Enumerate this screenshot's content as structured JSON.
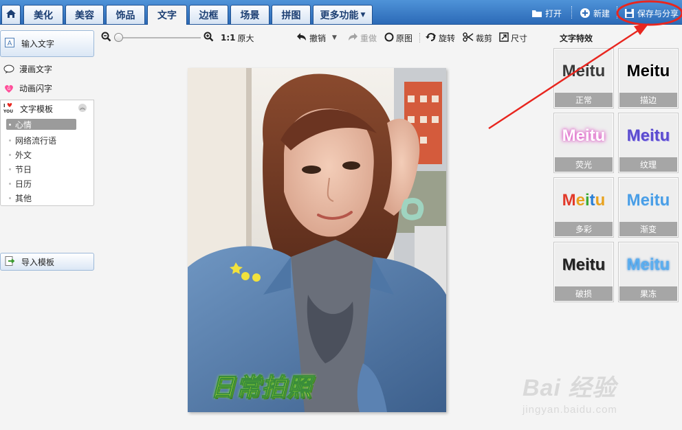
{
  "tabs": [
    {
      "id": "home",
      "label": ""
    },
    {
      "id": "beautify",
      "label": "美化"
    },
    {
      "id": "beauty",
      "label": "美容"
    },
    {
      "id": "accessories",
      "label": "饰品"
    },
    {
      "id": "text",
      "label": "文字"
    },
    {
      "id": "frame",
      "label": "边框"
    },
    {
      "id": "scene",
      "label": "场景"
    },
    {
      "id": "collage",
      "label": "拼图"
    },
    {
      "id": "more",
      "label": "更多功能"
    }
  ],
  "active_tab": "文字",
  "actions": {
    "open": "打开",
    "new": "新建",
    "save_share": "保存与分享"
  },
  "left": {
    "input_text": "输入文字",
    "comic_text": "漫画文字",
    "animated_text": "动画闪字",
    "text_template": "文字模板",
    "template_items": [
      "心情",
      "网络流行语",
      "外文",
      "节日",
      "日历",
      "其他"
    ],
    "selected_template": "心情",
    "import_template": "导入模板"
  },
  "toolbar": {
    "ratio": "1:1",
    "original_size": "原大",
    "undo": "撤销",
    "redo": "重做",
    "original": "原图",
    "rotate": "旋转",
    "crop": "裁剪",
    "size": "尺寸"
  },
  "zoom": {
    "level": 0.0
  },
  "canvas": {
    "caption": "日常拍照"
  },
  "effects": {
    "title": "文字特效",
    "items": [
      {
        "label": "正常",
        "preview": "Meitu",
        "style": "normal"
      },
      {
        "label": "描边",
        "preview": "Meitu",
        "style": "stroke"
      },
      {
        "label": "荧光",
        "preview": "Meitu",
        "style": "glow"
      },
      {
        "label": "纹理",
        "preview": "Meitu",
        "style": "texture"
      },
      {
        "label": "多彩",
        "preview": "Meitu",
        "style": "colorful"
      },
      {
        "label": "渐变",
        "preview": "Meitu",
        "style": "gradient"
      },
      {
        "label": "破损",
        "preview": "Meitu",
        "style": "damaged"
      },
      {
        "label": "果冻",
        "preview": "Meitu",
        "style": "jelly"
      }
    ]
  },
  "watermark": {
    "brand": "Bai 经验",
    "url": "jingyan.baidu.com"
  },
  "colors": {
    "topbar": "#3a7cc7",
    "annotation": "#e8261f",
    "caption_fill": "#e8ff2a",
    "caption_outline": "#3a8d3a"
  }
}
